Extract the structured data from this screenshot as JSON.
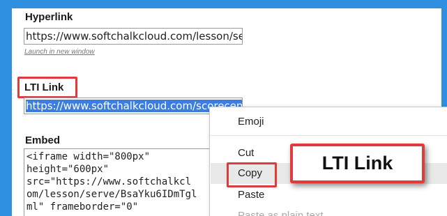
{
  "hyperlink": {
    "label": "Hyperlink",
    "url": "https://www.softchalkcloud.com/lesson/se",
    "launch_link": "Launch in new window"
  },
  "lti": {
    "label": "LTI Link",
    "url": "https://www.softchalkcloud.com/scorecen"
  },
  "embed": {
    "label": "Embed",
    "code": "<iframe width=\"800px\"\nheight=\"600px\"\nsrc=\"https://www.softchalkcl\nom/lesson/serve/BsaYku6IDmTgl\nml\" frameborder=\"0\""
  },
  "context_menu": {
    "items": [
      {
        "label": "Emoji",
        "enabled": true
      },
      {
        "label": "Cut",
        "enabled": true
      },
      {
        "label": "Copy",
        "enabled": true,
        "highlighted": true
      },
      {
        "label": "Paste",
        "enabled": true
      },
      {
        "label": "Paste as plain text",
        "enabled": false
      }
    ]
  },
  "callout": {
    "text": "LTI Link"
  },
  "colors": {
    "frame_border": "#2f8fe0",
    "highlight_red": "#e03a3a",
    "selection_blue": "#3b7ee0"
  }
}
